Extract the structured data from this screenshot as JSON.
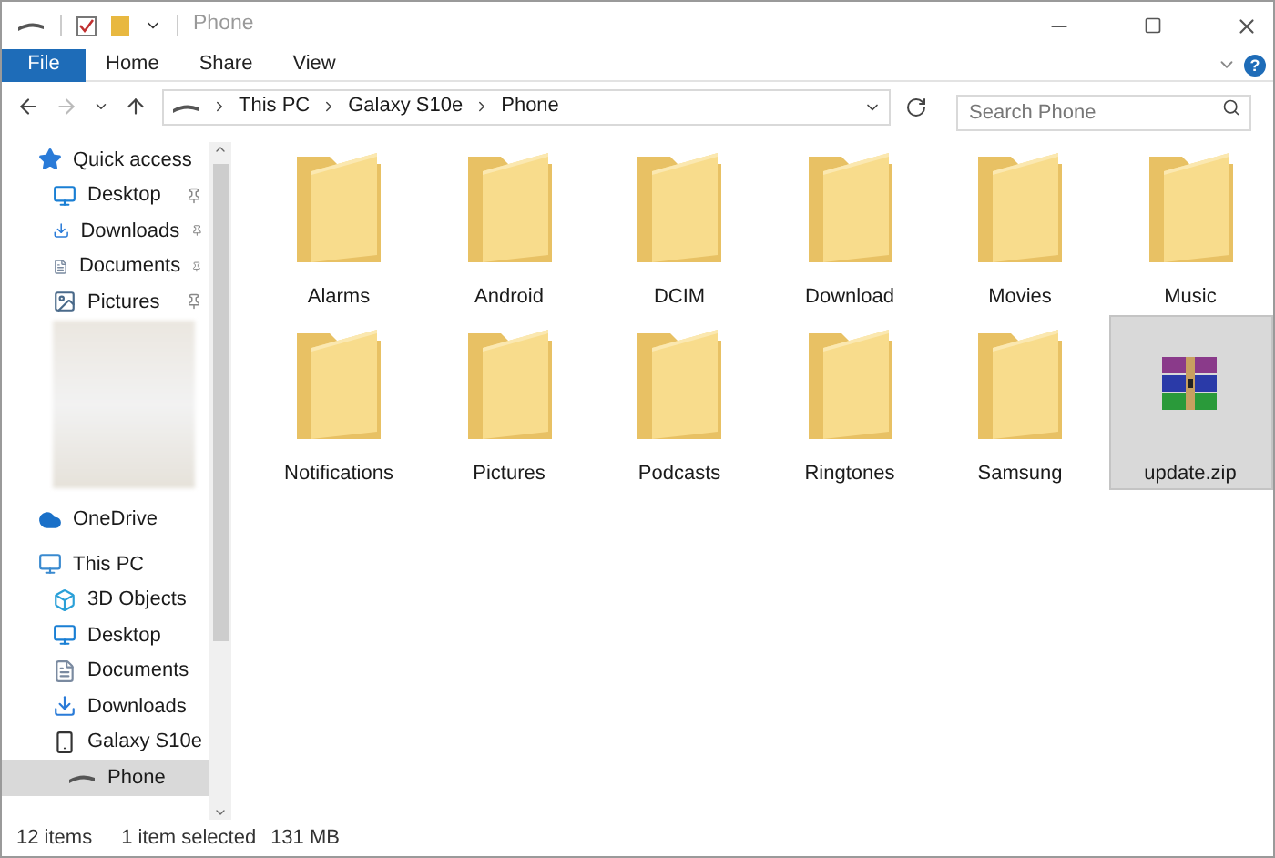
{
  "window": {
    "title": "Phone"
  },
  "ribbon_tabs": [
    {
      "label": "File",
      "kind": "menu"
    },
    {
      "label": "Home",
      "kind": "tab"
    },
    {
      "label": "Share",
      "kind": "tab"
    },
    {
      "label": "View",
      "kind": "tab"
    }
  ],
  "help_button": "?",
  "address_bar": {
    "path": [
      "This PC",
      "Galaxy S10e",
      "Phone"
    ]
  },
  "search": {
    "placeholder": "Search Phone"
  },
  "sidebar": {
    "items": [
      {
        "label": "Quick access",
        "kind": "star",
        "selected": false,
        "children": [
          {
            "label": "Desktop",
            "kind": "desktop",
            "pinned": true,
            "selected": false
          },
          {
            "label": "Downloads",
            "kind": "downloads",
            "pinned": true,
            "selected": false
          },
          {
            "label": "Documents",
            "kind": "documents",
            "pinned": true,
            "selected": false
          },
          {
            "label": "Pictures",
            "kind": "pictures",
            "pinned": true,
            "selected": false
          }
        ]
      },
      {
        "kind": "blurred"
      },
      {
        "label": "OneDrive",
        "kind": "cloud",
        "selected": false
      },
      {
        "label": "This PC",
        "kind": "pc",
        "selected": false,
        "children": [
          {
            "label": "3D Objects",
            "kind": "objects",
            "selected": false
          },
          {
            "label": "Desktop",
            "kind": "desktop",
            "selected": false
          },
          {
            "label": "Documents",
            "kind": "documents",
            "selected": false
          },
          {
            "label": "Downloads",
            "kind": "downloads",
            "selected": false
          },
          {
            "label": "Galaxy S10e",
            "kind": "device",
            "selected": false,
            "children": [
              {
                "label": "Phone",
                "kind": "drive",
                "selected": true
              }
            ]
          }
        ]
      }
    ]
  },
  "files": [
    {
      "name": "Alarms",
      "kind": "folder",
      "selected": false
    },
    {
      "name": "Android",
      "kind": "folder",
      "selected": false
    },
    {
      "name": "DCIM",
      "kind": "folder",
      "selected": false
    },
    {
      "name": "Download",
      "kind": "folder",
      "selected": false
    },
    {
      "name": "Movies",
      "kind": "folder",
      "selected": false
    },
    {
      "name": "Music",
      "kind": "folder",
      "selected": false
    },
    {
      "name": "Notifications",
      "kind": "folder",
      "selected": false
    },
    {
      "name": "Pictures",
      "kind": "folder",
      "selected": false
    },
    {
      "name": "Podcasts",
      "kind": "folder",
      "selected": false
    },
    {
      "name": "Ringtones",
      "kind": "folder",
      "selected": false
    },
    {
      "name": "Samsung",
      "kind": "folder",
      "selected": false
    },
    {
      "name": "update.zip",
      "kind": "archive",
      "selected": true
    }
  ],
  "status_bar": [
    "12 items",
    "1 item selected",
    "131 MB"
  ]
}
